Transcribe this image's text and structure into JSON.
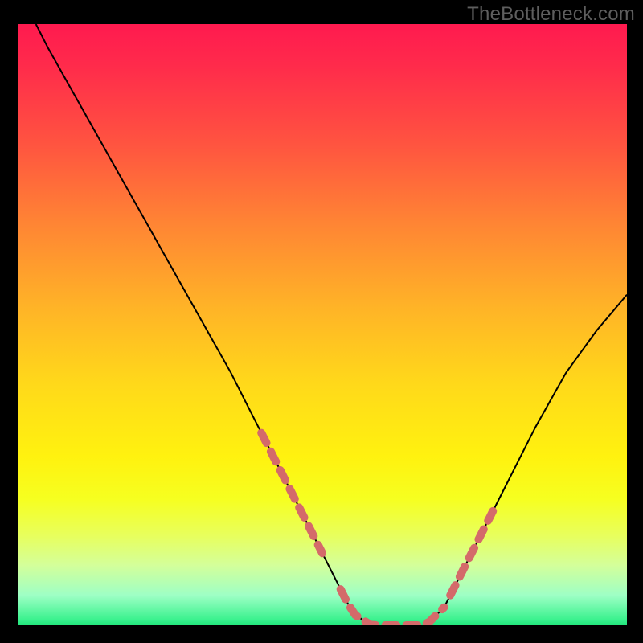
{
  "watermark": {
    "text": "TheBottleneck.com"
  },
  "chart_data": {
    "type": "line",
    "title": "",
    "xlabel": "",
    "ylabel": "",
    "xlim": [
      0,
      100
    ],
    "ylim": [
      0,
      100
    ],
    "grid": false,
    "legend": false,
    "description": "Single black V-shaped curve over a vertical rainbow gradient (red at top through yellow/green at bottom). Flat minimum near x≈55–67. Thick pink dashed segments overlay part of the descending and ascending flanks near the bottom.",
    "series": [
      {
        "name": "bottleneck-curve",
        "x": [
          3,
          5,
          10,
          15,
          20,
          25,
          30,
          35,
          38,
          40,
          43,
          46,
          49,
          52,
          55,
          58,
          61,
          64,
          67,
          70,
          73,
          76,
          80,
          85,
          90,
          95,
          100
        ],
        "values": [
          100,
          96,
          87,
          78,
          69,
          60,
          51,
          42,
          36,
          32,
          26,
          20,
          14,
          8,
          2,
          0,
          0,
          0,
          0,
          3,
          9,
          15,
          23,
          33,
          42,
          49,
          55
        ]
      }
    ],
    "annotations": {
      "thick_overlay_ranges_x": [
        {
          "start": 40,
          "end": 50
        },
        {
          "start": 53,
          "end": 70
        },
        {
          "start": 71,
          "end": 78
        }
      ],
      "overlay_color": "#d46a6a"
    },
    "gradient_stops": [
      {
        "pct": 0,
        "color": "#ff1a4f"
      },
      {
        "pct": 20,
        "color": "#ff5440"
      },
      {
        "pct": 47,
        "color": "#ffb327"
      },
      {
        "pct": 72,
        "color": "#fff20f"
      },
      {
        "pct": 90,
        "color": "#d4ff9a"
      },
      {
        "pct": 100,
        "color": "#1fe47a"
      }
    ]
  }
}
